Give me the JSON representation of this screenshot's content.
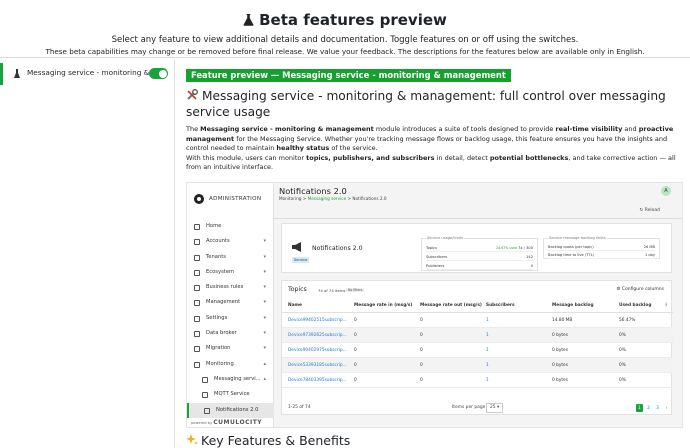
{
  "header": {
    "title": "Beta features preview",
    "subtitle": "Select any feature to view additional details and documentation. Toggle features on or off using the switches.",
    "note": "These beta capabilities may change or be removed before final release. We value your feedback. The descriptions for the features below are available only in English."
  },
  "sidebar": {
    "items": [
      {
        "label": "Messaging service - monitoring & manag",
        "enabled": true
      }
    ]
  },
  "feature": {
    "badge": "Feature preview — Messaging service - monitoring & management",
    "title": "Messaging service - monitoring & management: full control over messaging service usage",
    "desc": {
      "p1_a": "The ",
      "p1_b": "Messaging service - monitoring & management",
      "p1_c": " module introduces a suite of tools designed to provide ",
      "p1_d": "real-time visibility",
      "p1_e": " and ",
      "p1_f": "proactive management",
      "p1_g": " for the Messaging Service. Whether you're tracking message flows or backlog usage, this feature ensures you have the insights and control needed to maintain ",
      "p1_h": "healthy status",
      "p1_i": " of the service.",
      "p2_a": "With this module, users can monitor ",
      "p2_b": "topics, publishers, and subscribers",
      "p2_c": " in detail, detect ",
      "p2_d": "potential bottlenecks",
      "p2_e": ", and take corrective action — all from an intuitive interface."
    },
    "key_features_title": "Key Features & Benefits"
  },
  "screenshot": {
    "brand": "ADMINISTRATION",
    "nav": [
      {
        "label": "Home",
        "caret": ""
      },
      {
        "label": "Accounts",
        "caret": "▾"
      },
      {
        "label": "Tenants",
        "caret": "▾"
      },
      {
        "label": "Ecosystem",
        "caret": "▾"
      },
      {
        "label": "Business rules",
        "caret": "▾"
      },
      {
        "label": "Management",
        "caret": "▾"
      },
      {
        "label": "Settings",
        "caret": "▾"
      },
      {
        "label": "Data broker",
        "caret": "▾"
      },
      {
        "label": "Migration",
        "caret": "▾"
      },
      {
        "label": "Monitoring",
        "caret": "▴"
      },
      {
        "label": "Messaging servi...",
        "caret": "▴"
      },
      {
        "label": "MQTT Service",
        "caret": ""
      },
      {
        "label": "Notifications 2.0",
        "caret": ""
      }
    ],
    "powered_by": "powered by",
    "powered_brand": "CUMULOCITY",
    "page_title": "Notifications 2.0",
    "breadcrumb": {
      "a": "Monitoring",
      "b": "Messaging service",
      "c": "Notifications 2.0",
      "sep": " > "
    },
    "avatar": "A",
    "reload": "Reload",
    "card": {
      "title": "Notifications 2.0",
      "tag": "Service",
      "usage_label": "Service usage/limits",
      "usage_rows": [
        {
          "label": "Topics",
          "pct": "24.67% used",
          "value": "74 / 300"
        },
        {
          "label": "Subscribers",
          "pct": "",
          "value": "142"
        },
        {
          "label": "Publishers",
          "pct": "",
          "value": "0"
        }
      ],
      "backlog_label": "Service message backlog limits",
      "backlog_rows": [
        {
          "label": "Backlog quota (per topic)",
          "value": "26 MB"
        },
        {
          "label": "Backlog time to live (TTL)",
          "value": "1 day"
        }
      ]
    },
    "table": {
      "title": "Topics",
      "count": "74 of 74 items",
      "filter": "No filters",
      "configure": "Configure columns",
      "columns": [
        "Name",
        "Message rate in (msg/s)",
        "Message rate out (msg/s)",
        "Subscribers",
        "Message backlog",
        "Used backlog"
      ],
      "rows": [
        {
          "name": "Device99402515subscrip...",
          "rate_in": "0",
          "rate_out": "0",
          "subs": "1",
          "backlog": "14.80 MB",
          "used": "56.47%"
        },
        {
          "name": "Device97392625subscrip...",
          "rate_in": "0",
          "rate_out": "0",
          "subs": "1",
          "backlog": "0 bytes",
          "used": "0%"
        },
        {
          "name": "Device90402975subscrip...",
          "rate_in": "0",
          "rate_out": "0",
          "subs": "1",
          "backlog": "0 bytes",
          "used": "0%"
        },
        {
          "name": "Device53393185subscrip...",
          "rate_in": "0",
          "rate_out": "0",
          "subs": "1",
          "backlog": "0 bytes",
          "used": "0%"
        },
        {
          "name": "Device78403395subscrip...",
          "rate_in": "0",
          "rate_out": "0",
          "subs": "1",
          "backlog": "0 bytes",
          "used": "0%"
        }
      ],
      "footer_range": "1-25 of 74",
      "per_page_label": "Items per page",
      "per_page": "25",
      "pages": [
        "1",
        "2",
        "3"
      ],
      "next": "›"
    }
  },
  "colors": {
    "accent": "#1aa33a",
    "link": "#2279d4"
  }
}
